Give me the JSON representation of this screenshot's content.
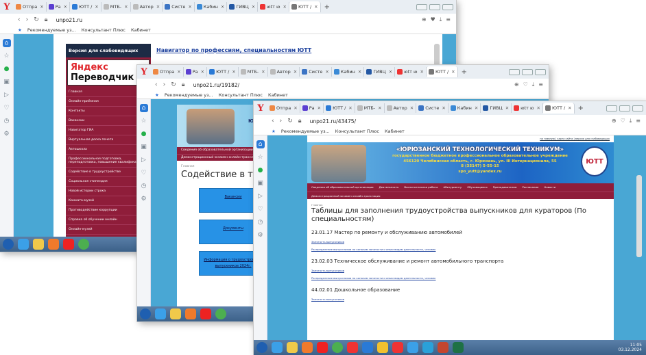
{
  "w1": {
    "tabs": [
      "Отпра",
      "Ра",
      "ЮТТ /",
      "МТБ-",
      "Автор",
      "Систе",
      "Кабин",
      "ГИВЦ",
      "юtт ю",
      "ЮТТ /"
    ],
    "url": "unpo21.ru",
    "bookmarks": [
      "Рекомендуемые уз...",
      "Консультант Плюс",
      "Кабинет"
    ],
    "banner": "Версия для слабовидящих",
    "yandex": {
      "a": "Яндекс",
      "b": " Переводчик"
    },
    "menu": [
      "Главная",
      "Онлайн-приёмная",
      "Контакты",
      "Вакансии",
      "Навигатор ГИА",
      "Виртуальная доска почета",
      "Автошкола",
      "Профессиональная подготовка, переподготовка, повышение квалификации",
      "Содействие в трудоустройстве",
      "Социальная стипендия",
      "Новой истории строка",
      "Комната-музей",
      "Противодействие коррупции",
      "Справка об обучении онлайн",
      "Онлайн-музей",
      "Правовые новости и правовое информирование"
    ],
    "navlink": "Навигатор по профессиям, специальностям ЮТТ"
  },
  "w2": {
    "tabs": [
      "Отпра",
      "Ра",
      "ЮТТ /",
      "МТБ-",
      "Автор",
      "Систе",
      "Кабин",
      "ГИВЦ",
      "юtт ю",
      "ЮТТ /"
    ],
    "url": "unpo21.ru/19182/",
    "bookmarks": [
      "Рекомендуемые уз...",
      "Консультант Плюс",
      "Кабинет"
    ],
    "header_text": "ЮРЮ",
    "strip1": "Сведения об образовательной организации",
    "strip2": "Демонстрационный экзамен онлайн-трансляция",
    "crumb": "Главная",
    "title": "Содействие в трудо",
    "buttons": [
      "Вакансии",
      "Документы",
      "Информация о трудоустройстве выпускников 2024г."
    ]
  },
  "w3": {
    "tabs": [
      "Отпра",
      "Ра",
      "ЮТТ /",
      "МТБ-",
      "Автор",
      "Систе",
      "Кабин",
      "ГИВЦ",
      "юtт ю",
      "ЮТТ /"
    ],
    "url": "unpo21.ru/43475/",
    "bookmarks": [
      "Рекомендуемые уз...",
      "Консультант Плюс",
      "Кабинет"
    ],
    "toplinks": "на главную | карта сайта | версия для слабовидящих",
    "college": "«ЮРЮЗАНСКИЙ ТЕХНОЛОГИЧЕСКИЙ ТЕХНИКУМ»",
    "subtitle": "государственное бюджетное профессиональное образовательное учреждение",
    "address": "456120 Челябинская область, г. Юрюзань, ул. III Интернационала, 55",
    "phone": "8 (35147) 5-55-15",
    "email": "spo_yutt@yandex.ru",
    "logo": "ЮТТ",
    "menu": [
      "Сведения об образовательной организации",
      "Деятельность",
      "Воспитательная работа",
      "Абитуриенту",
      "Обучающимся",
      "Преподавателям",
      "Расписание",
      "Новости"
    ],
    "menu2": "Демонстрационный экзамен онлайн-трансляция",
    "crumb": "Главная",
    "title": "Таблицы для заполнения трудоустройства выпускников для кураторов (По специальностям)",
    "sections": [
      {
        "heading": "23.01.17 Мастер по ремонту и обслуживанию автомобилей",
        "links": [
          "Занятость выпускников",
          "Распределение выпускников по каналам занятости и иным видам деятельности, человек"
        ]
      },
      {
        "heading": "23.02.03 Техническое обслуживание и ремонт автомобильного транспорта",
        "links": [
          "Занятость выпускников",
          "Распределение выпускников по каналам занятости и иным видам деятельности, человек"
        ]
      },
      {
        "heading": "44.02.01 Дошкольное образование",
        "links": [
          "Занятость выпускников"
        ]
      }
    ],
    "clock": {
      "time": "11:05",
      "date": "03.12.2024",
      "lang": "RU"
    }
  }
}
